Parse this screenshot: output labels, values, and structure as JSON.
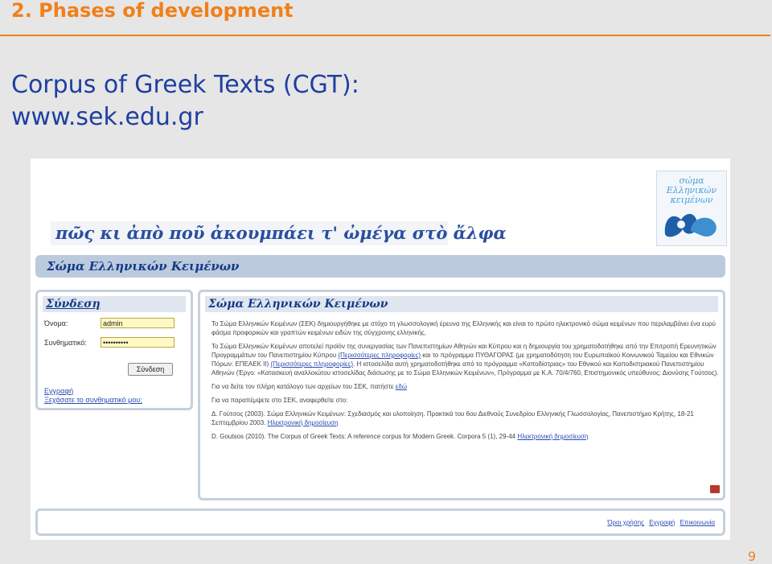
{
  "slide": {
    "title": "2. Phases of development",
    "heading_line1": "Corpus of Greek Texts (CGT):",
    "heading_line2": "www.sek.edu.gr",
    "page_number": "9"
  },
  "site": {
    "motto": "πῶς κι ἀπὸ ποῦ ἀκουμπάει τ' ὠμέγα στὸ ἄλφα",
    "logo_text": "σώμα Ελληνικών κειμένων",
    "subheader": "Σώμα Ελληνικών Κειμένων"
  },
  "login": {
    "title": "Σύνδεση",
    "username_label": "Όνομα:",
    "username_value": "admin",
    "password_label": "Συνθηματικό:",
    "password_value": "••••••••••",
    "button_label": "Σύνδεση",
    "link1": "Εγγραφή",
    "link2": "Ξεχάσατε το συνθηματικό μου;"
  },
  "main": {
    "title": "Σώμα Ελληνικών Κειμένων",
    "p1": "Το Σώμα Ελληνικών Κειμένων (ΣΕΚ) δημιουργήθηκε με στόχο τη γλωσσολογική έρευνα της Ελληνικής και είναι το πρώτο ηλεκτρονικό σώμα κειμένων που περιλαμβάνει ένα ευρύ φάσμα προφορικών και γραπτών κειμένων ειδών της σύγχρονης ελληνικής.",
    "p2": "Το Σώμα Ελληνικών Κειμένων αποτελεί προϊόν της συνεργασίας των Πανεπιστημίων Αθηνών και Κύπρου και η δημιουργία του χρηματοδοτήθηκε από την Επιτροπή Ερευνητικών Προγραμμάτων του Πανεπιστημίου Κύπρου",
    "p2_link1": "(Περισσότερες πληροφορίες)",
    "p2b": "και το πρόγραμμα ΠΥΘΑΓΟΡΑΣ (με χρηματοδότηση του Ευρωπαϊκού Κοινωνικού Ταμείου και Εθνικών Πόρων: ΕΠΕΑΕΚ II)",
    "p2_link2": "(Περισσότερες πληροφορίες)",
    "p2c": ". Η ιστοσελίδα αυτή χρηματοδοτήθηκε από το πρόγραμμα «Καποδίστριας» του Εθνικού και Καποδιστριακού Πανεπιστημίου Αθηνών (Έργο: «Κατασκευή αναλλοιώτου ιστοσελίδας διάσωσης με το Σώμα Ελληνικών Κειμένων», Πρόγραμμα με Κ.Α. 70/4/760, Επιστημονικός υπεύθυνος: Διονύσης Γούτσος).",
    "p3_text": "Για να δείτε τον πλήρη κατάλογο των αρχείων του ΣΕΚ, πατήστε",
    "p3_link": "εδώ",
    "p4": "Για να παραπέμψετε στο ΣΕΚ, αναφερθείτε στο:",
    "p5": "Δ. Γούτσος (2003). Σώμα Ελληνικών Κειμένων: Σχεδιασμός και υλοποίηση. Πρακτικά του 6ου Διεθνούς Συνεδρίου Ελληνικής Γλωσσολογίας, Πανεπιστήμιο Κρήτης, 18-21 Σεπτεμβρίου 2003.",
    "p5_link": "Ηλεκτρονική δημοσίευση",
    "p6": "D. Goutsos (2010). The Corpus of Greek Texts: A reference corpus for Modern Greek. Corpora 5 (1), 29-44",
    "p6_link": "Ηλεκτρονική δημοσίευση"
  },
  "footer": {
    "link1": "Όροι χρήσης",
    "link2": "Εγγραφή",
    "link3": "Επικοινωνία"
  }
}
